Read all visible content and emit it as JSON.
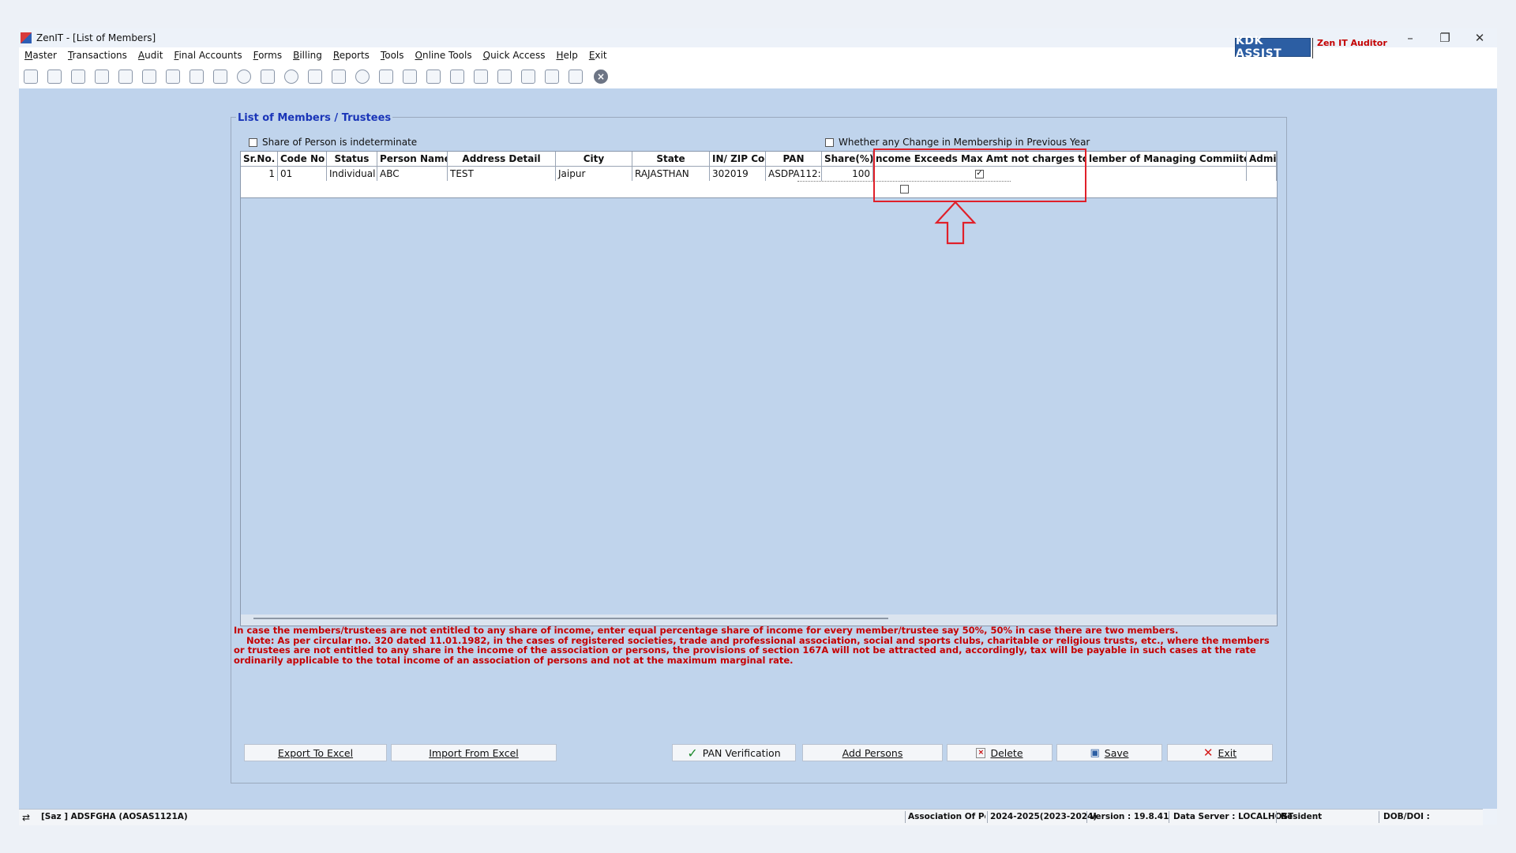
{
  "window": {
    "title": "ZenIT - [List of Members]",
    "controls": [
      "–",
      "❐",
      "✕"
    ]
  },
  "menu": [
    "Master",
    "Transactions",
    "Audit",
    "Final Accounts",
    "Forms",
    "Billing",
    "Reports",
    "Tools",
    "Online Tools",
    "Quick Access",
    "Help",
    "Exit"
  ],
  "toolbar": {
    "icons": [
      "calculator-icon",
      "home-icon",
      "buildings-icon",
      "bar-chart-icon",
      "gift-icon",
      "people-icon",
      "gavel-icon",
      "filter-icon",
      "save-disk-icon",
      "globe-icon",
      "ledger-icon",
      "pie-chart-icon",
      "person-pay-icon",
      "book-icon",
      "info-icon",
      "report-icon",
      "document-user-icon",
      "calendar-icon",
      "settings-icon",
      "refresh-icon",
      "bs-icon",
      "bank-icon",
      "3cd-icon",
      "form-icon",
      "close-circle-icon"
    ],
    "kdk_label": "KDK ASSIST",
    "zen_label": "Zen IT Auditor"
  },
  "panel": {
    "title": "List of Members / Trustees",
    "share_indeterminate_label": "Share of Person is indeterminate",
    "share_indeterminate_checked": false,
    "membership_change_label": "Whether any Change in Membership in Previous Year",
    "membership_change_checked": false
  },
  "grid": {
    "columns": [
      "Sr.No.",
      "Code No",
      "Status",
      "Person Name",
      "Address Detail",
      "City",
      "State",
      "IN/ ZIP Cod",
      "PAN",
      "Share(%)",
      "ncome Exceeds Max Amt not charges to Ta",
      "lember of Managing Commiitee",
      "Admit"
    ],
    "rows": [
      {
        "sr": "1",
        "code": "01",
        "status": "Individual",
        "name": "ABC",
        "address": "TEST",
        "city": "Jaipur",
        "state": "RAJASTHAN",
        "zip": "302019",
        "pan": "ASDPA112:",
        "share": "100",
        "income_exceeds": true
      }
    ],
    "blank_row_income_exceeds": false
  },
  "note": {
    "line1": "In case the members/trustees are not entitled to any share of income, enter equal percentage share of income for every member/trustee say 50%, 50% in case there are two members.",
    "line2": "Note: As per circular no. 320 dated 11.01.1982, in the cases of registered societies, trade and professional association, social and sports clubs, charitable or religious trusts, etc., where the members or trustees are not entitled to any share in the income of the association or persons, the provisions of section 167A will not be attracted and, accordingly, tax will be payable in such cases at the rate ordinarily applicable to the total income of an association of persons and not at the maximum marginal rate."
  },
  "buttons": {
    "export_excel": "Export To Excel",
    "import_excel": "Import From Excel",
    "pan_verification": "PAN Verification",
    "add_persons": "Add Persons",
    "delete": "Delete",
    "save": "Save",
    "exit": "Exit"
  },
  "status": {
    "client": "[Saz ] ADSFGHA (AOSAS1121A)",
    "assessee_type": "Association Of Persi",
    "year": "2024-2025(2023-2024)",
    "version": "Version : 19.8.41",
    "server": "Data Server : LOCALHOST",
    "residency": "Resident",
    "dob": "DOB/DOI :"
  },
  "colors": {
    "workspace": "#bfd3ec",
    "accent_blue": "#1a35b8",
    "note_red": "#c60000",
    "highlight_red": "#e0202a",
    "kdk_blue": "#2c5ea3"
  }
}
